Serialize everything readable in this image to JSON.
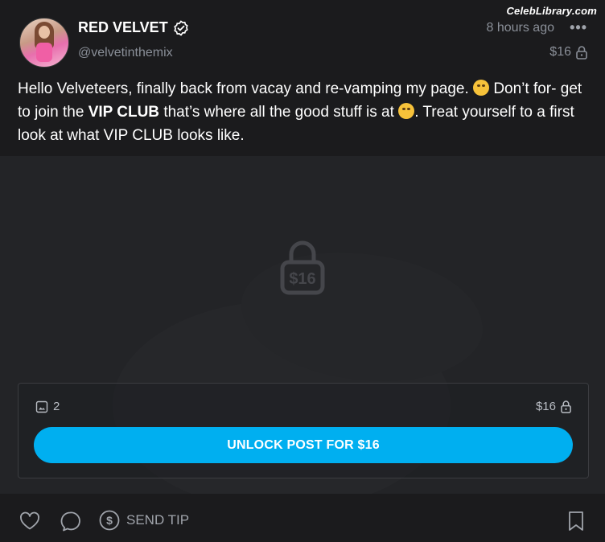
{
  "watermark": "CelebLibrary.com",
  "author": {
    "name": "RED VELVET",
    "handle": "@velvetinthemix",
    "verified_icon": "verified-check-icon"
  },
  "meta": {
    "time": "8 hours ago",
    "more": "•••",
    "price": "$16"
  },
  "post": {
    "line1_a": "Hello Velveteers, finally back from vacay and re-vamping my page.",
    "line1_b": "Don’t for-",
    "line2_a": "get to join the",
    "vip": "VIP CLUB",
    "line2_b": "that’s where all the good stuff is at",
    "line2_c": ". Treat yourself to",
    "line3": "a first look at what VIP CLUB looks like."
  },
  "media": {
    "lock_price": "$16",
    "lock_icon": "padlock-icon"
  },
  "panel": {
    "media_count": "2",
    "price": "$16",
    "unlock_label": "UNLOCK POST FOR $16"
  },
  "footer": {
    "tip_label": "SEND TIP"
  },
  "colors": {
    "accent": "#00aff0",
    "background": "#1b1b1d",
    "muted_text": "#8a8f98"
  }
}
